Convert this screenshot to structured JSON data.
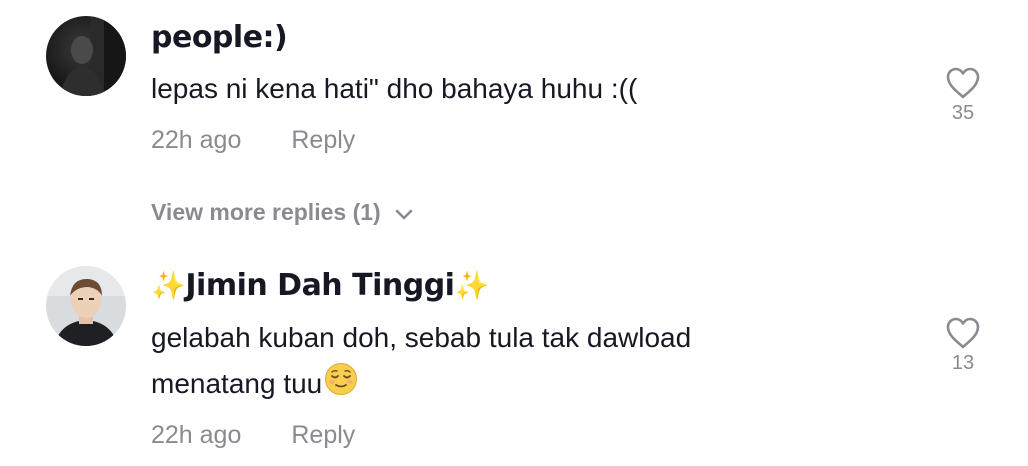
{
  "comments": [
    {
      "username": "people:)",
      "text": "lepas ni kena hati\" dho bahaya huhu :((",
      "time": "22h ago",
      "reply_label": "Reply",
      "like_count": "35",
      "like_icon": "heart-outline-icon"
    },
    {
      "username_prefix": "✨",
      "username": "Jimin Dah Tinggi",
      "username_suffix": "✨",
      "text_line1": "gelabah kuban doh, sebab tula tak dawload",
      "text_line2": "menatang tuu",
      "text_emoji": "relieved-face-emoji",
      "time": "22h ago",
      "reply_label": "Reply",
      "like_count": "13",
      "like_icon": "heart-outline-icon"
    }
  ],
  "view_more": {
    "label": "View more replies (1)",
    "icon": "chevron-down-icon"
  },
  "colors": {
    "text_primary": "#161823",
    "text_secondary": "#8a8b91",
    "sparkle": "#f5c518"
  }
}
